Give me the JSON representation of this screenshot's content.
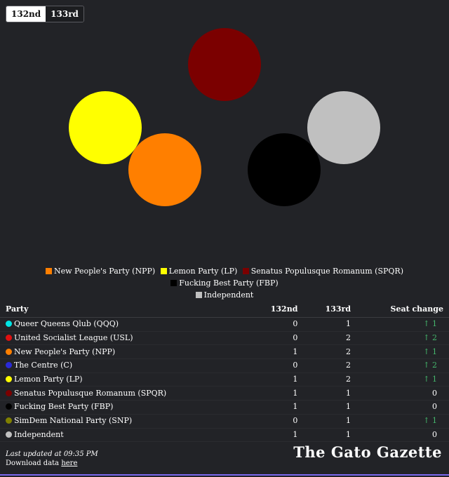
{
  "tabs": [
    {
      "label": "132nd",
      "active": true
    },
    {
      "label": "133rd",
      "active": false
    }
  ],
  "chart_data": {
    "type": "circles",
    "session": "132nd",
    "circles": [
      {
        "party": "Senatus Populusque Romanum (SPQR)",
        "color": "#7b0000"
      },
      {
        "party": "Lemon Party (LP)",
        "color": "#ffff00"
      },
      {
        "party": "Independent",
        "color": "#c0c0c0"
      },
      {
        "party": "New People's Party (NPP)",
        "color": "#ff7f00"
      },
      {
        "party": "Fucking Best Party (FBP)",
        "color": "#000000"
      }
    ]
  },
  "legend": [
    {
      "label": "New People's Party (NPP)",
      "color": "#ff7f00"
    },
    {
      "label": "Lemon Party (LP)",
      "color": "#ffff00"
    },
    {
      "label": "Senatus Populusque Romanum (SPQR)",
      "color": "#7b0000"
    },
    {
      "label": "Fucking Best Party (FBP)",
      "color": "#000000"
    },
    {
      "label": "Independent",
      "color": "#c0c0c0"
    }
  ],
  "table": {
    "headers": {
      "party": "Party",
      "s132": "132nd",
      "s133": "133rd",
      "change": "Seat change"
    },
    "rows": [
      {
        "party": "Queer Queens Qlub (QQQ)",
        "color": "#00e5e5",
        "s132": "0",
        "s133": "1",
        "change": "↑ 1"
      },
      {
        "party": "United Socialist League (USL)",
        "color": "#e01010",
        "s132": "0",
        "s133": "2",
        "change": "↑ 2"
      },
      {
        "party": "New People's Party (NPP)",
        "color": "#ff7f00",
        "s132": "1",
        "s133": "2",
        "change": "↑ 1"
      },
      {
        "party": "The Centre (C)",
        "color": "#2a2ad8",
        "s132": "0",
        "s133": "2",
        "change": "↑ 2"
      },
      {
        "party": "Lemon Party (LP)",
        "color": "#ffff00",
        "s132": "1",
        "s133": "2",
        "change": "↑ 1"
      },
      {
        "party": "Senatus Populusque Romanum (SPQR)",
        "color": "#7b0000",
        "s132": "1",
        "s133": "1",
        "change": "0"
      },
      {
        "party": "Fucking Best Party (FBP)",
        "color": "#000000",
        "s132": "1",
        "s133": "1",
        "change": "0"
      },
      {
        "party": "SimDem National Party (SNP)",
        "color": "#808000",
        "s132": "0",
        "s133": "1",
        "change": "↑ 1"
      },
      {
        "party": "Independent",
        "color": "#c0c0c0",
        "s132": "1",
        "s133": "1",
        "change": "0"
      }
    ]
  },
  "footer": {
    "updated": "Last updated at 09:35 PM",
    "download_prefix": "Download data ",
    "download_link": "here",
    "brand": "The Gato Gazette"
  },
  "colors": {
    "background": "#222327",
    "accent": "#7b68ee",
    "increase": "#45b86d"
  }
}
